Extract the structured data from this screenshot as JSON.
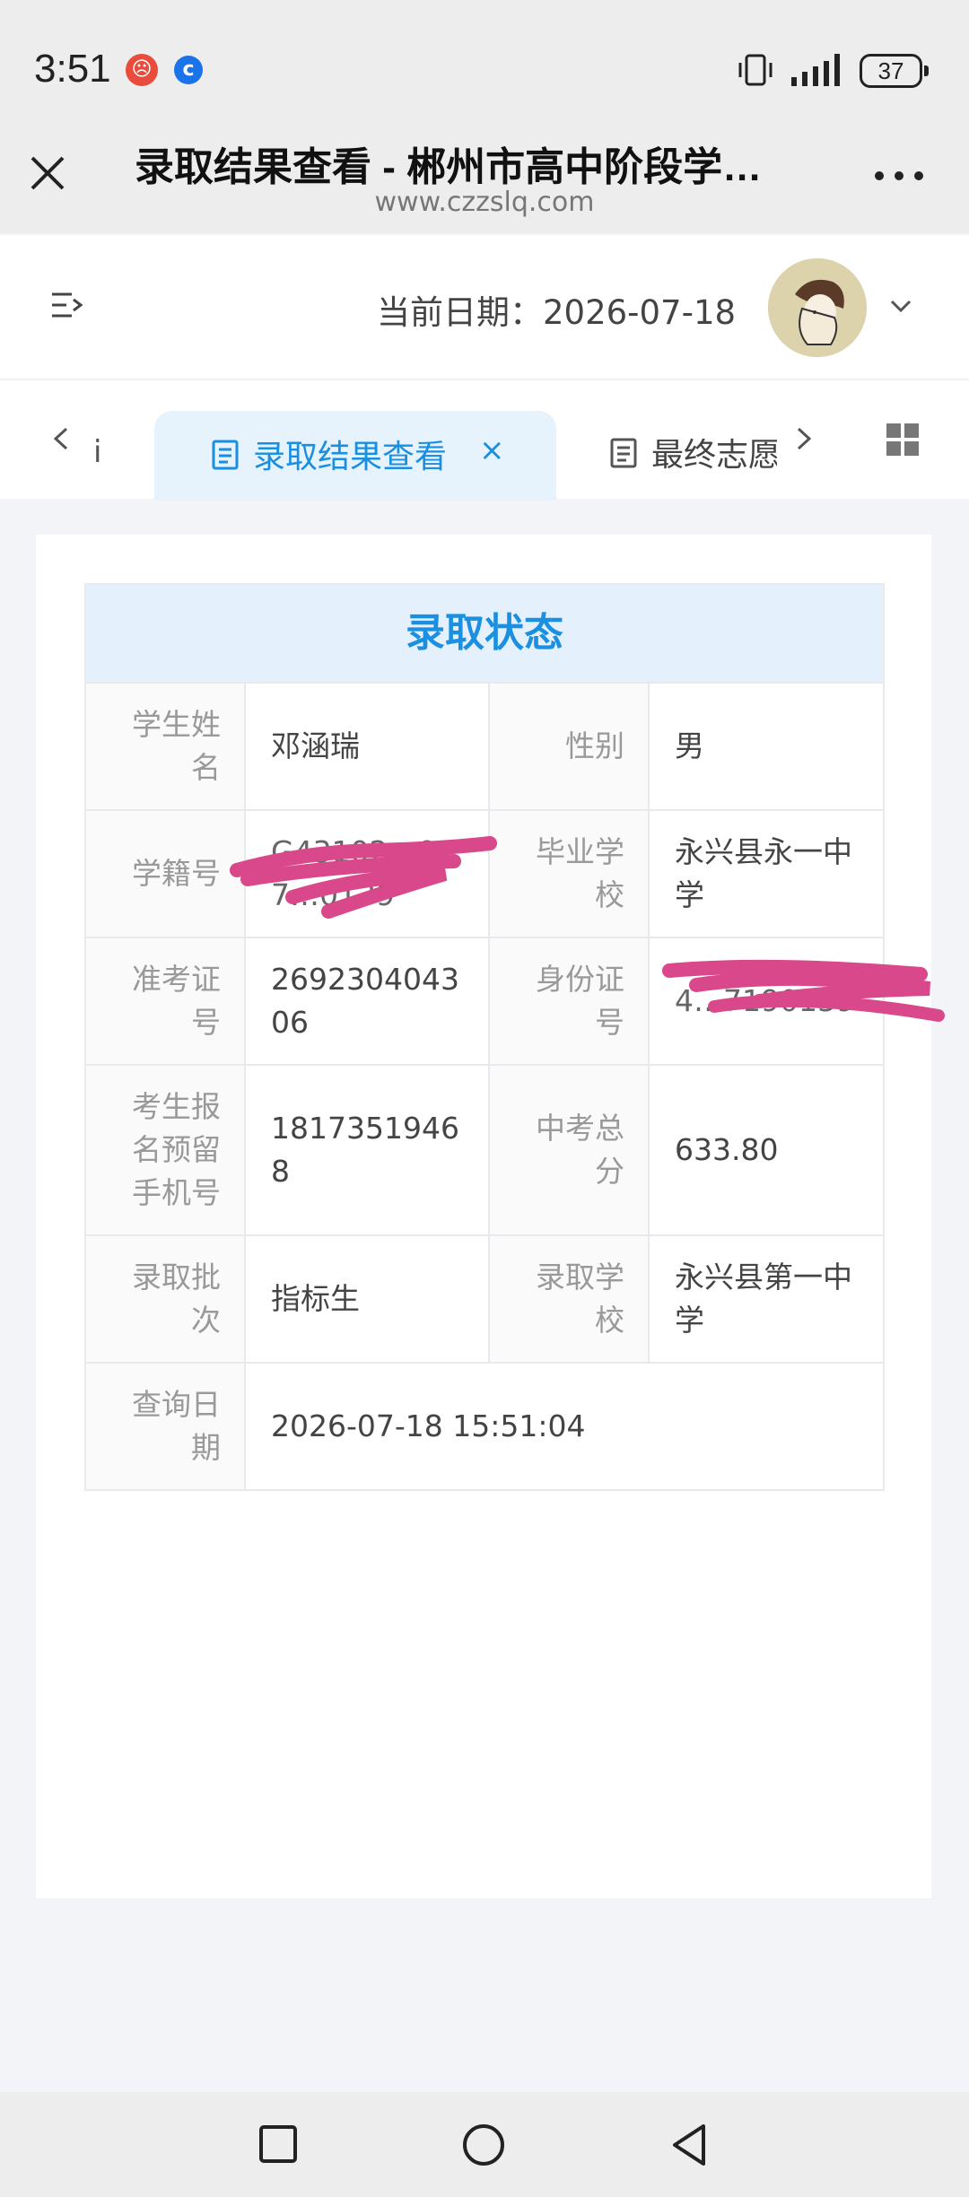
{
  "status_bar": {
    "time": "3:51",
    "battery": "37"
  },
  "browser": {
    "title": "录取结果查看 - 郴州市高中阶段学…",
    "url": "www.czzslq.com"
  },
  "app_header": {
    "current_date": "当前日期：2026-07-18"
  },
  "tabs": {
    "partial_left": "i",
    "active_label": "录取结果查看",
    "active_close": "×",
    "other_label": "最终志愿"
  },
  "table": {
    "title": "录取状态",
    "rows": [
      {
        "l1": "学生姓名",
        "v1": "邓涵瑞",
        "l2": "性别",
        "v2": "男"
      },
      {
        "l1": "学籍号",
        "v1": "G43102…07…0139",
        "l2": "毕业学校",
        "v2": "永兴县永一中学"
      },
      {
        "l1": "准考证号",
        "v1": "269230404306",
        "l2": "身份证号",
        "v2": "4…7190139"
      },
      {
        "l1": "考生报名预留手机号",
        "v1": "18173519468",
        "l2": "中考总分",
        "v2": "633.80"
      },
      {
        "l1": "录取批次",
        "v1": "指标生",
        "l2": "录取学校",
        "v2": "永兴县第一中学"
      }
    ],
    "last_row": {
      "l1": "查询日期",
      "v1": "2026-07-18 15:51:04"
    }
  },
  "colors": {
    "accent": "#1a8fe0",
    "header_bg": "#e4f0fc",
    "redaction": "#d9488a"
  },
  "icons": {
    "close": "close-icon",
    "more": "more-dots-icon",
    "menu": "menu-collapse-icon",
    "grid": "grid-icon",
    "doc": "document-icon"
  }
}
